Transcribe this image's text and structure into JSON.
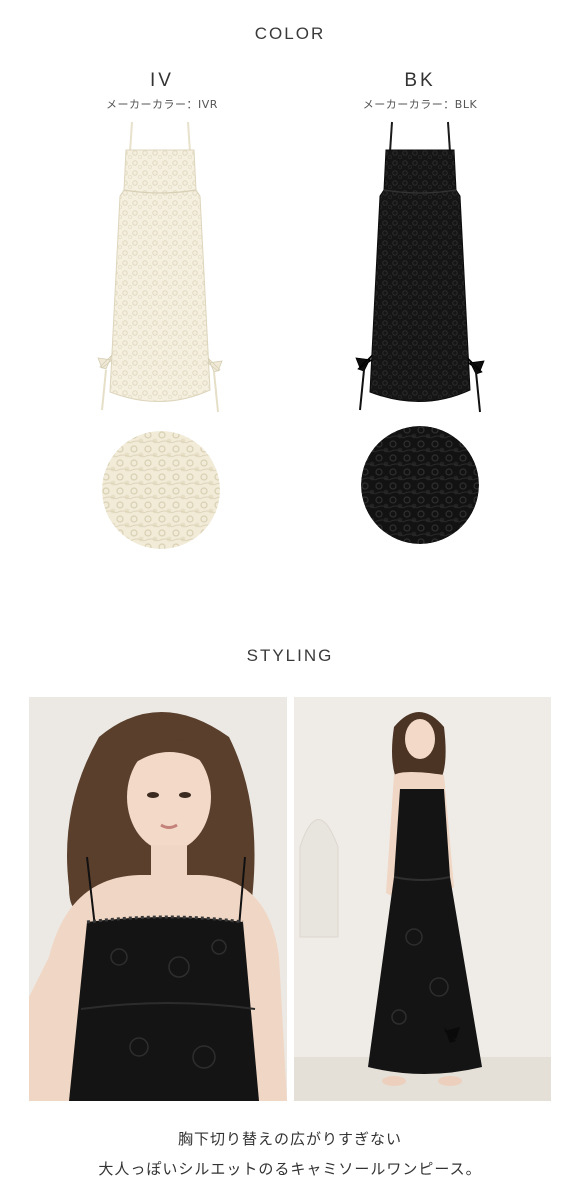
{
  "color_section": {
    "title": "COLOR",
    "variants": [
      {
        "code": "IV",
        "maker_color": "メーカーカラー：IVR",
        "dress_color": "#f3eedc",
        "lace_color": "#e3dcc4"
      },
      {
        "code": "BK",
        "maker_color": "メーカーカラー：BLK",
        "dress_color": "#141414",
        "lace_color": "#2c2c2c"
      }
    ]
  },
  "styling_section": {
    "title": "STYLING",
    "caption_line1": "胸下切り替えの広がりすぎない",
    "caption_line2": "大人っぽいシルエットのるキャミソールワンピース。"
  }
}
